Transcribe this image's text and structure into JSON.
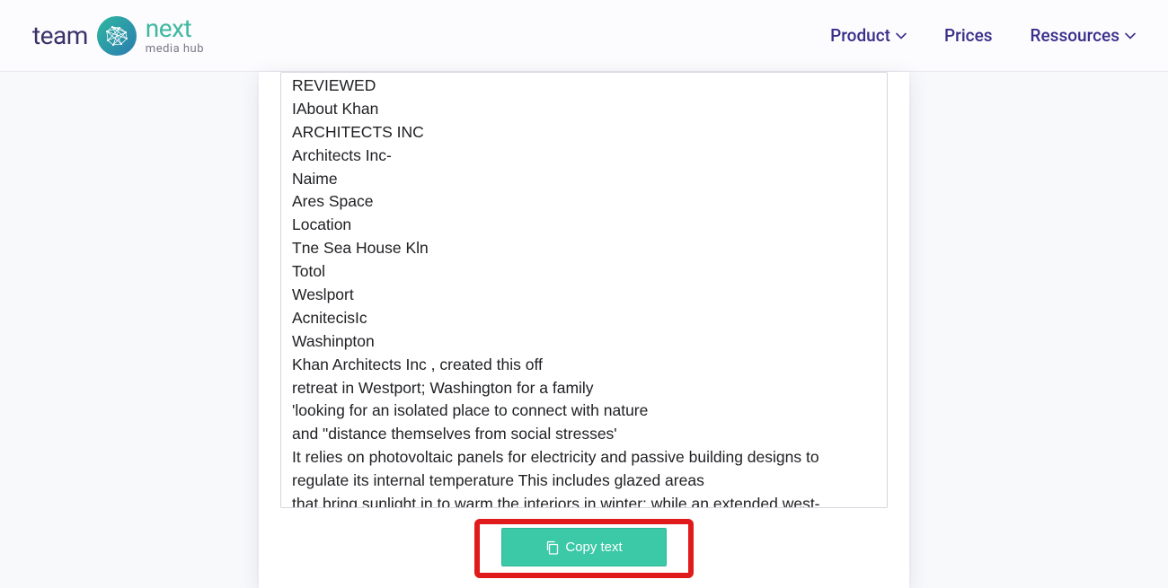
{
  "logo": {
    "left": "team",
    "right": "next",
    "sub": "media hub"
  },
  "nav": {
    "product": "Product",
    "prices": "Prices",
    "resources": "Ressources"
  },
  "main": {
    "text_content": "REVIEWED\nIAbout Khan\nARCHITECTS INC\nArchitects Inc-\nNaime\nAres Space\nLocation\nTne Sea House Kln\nTotol\nWeslport\nAcnitecisIc\nWashinpton\nKhan Architects Inc , created this off\nretreat in Westport; Washington for a family\n'looking for an isolated place to connect with nature\nand \"distance themselves from social stresses'\nIt relies on photovoltaic panels for electricity and passive building designs to regulate its internal temperature This includes glazed areas\nthat bring sunlight in to warm the interiors in winter; while an extended west-",
    "copy_label": "Copy text"
  }
}
